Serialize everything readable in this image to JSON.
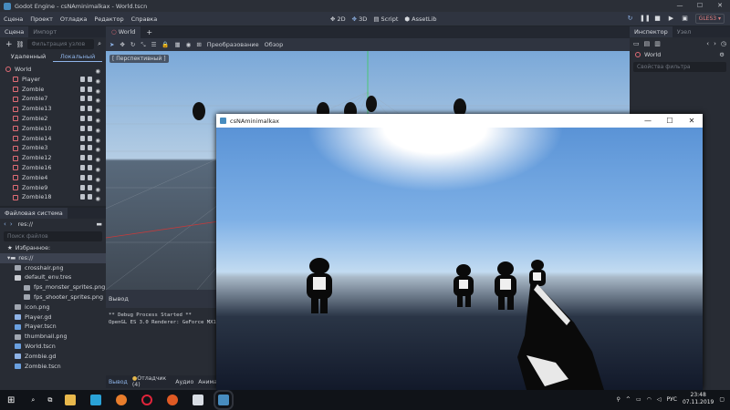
{
  "window": {
    "title": "Godot Engine - csNAminimalkax - World.tscn",
    "min": "—",
    "max": "☐",
    "close": "✕"
  },
  "menu": [
    "Сцена",
    "Проект",
    "Отладка",
    "Редактор",
    "Справка"
  ],
  "workspaces": {
    "d2": "2D",
    "d3": "3D",
    "script": "Script",
    "assetlib": "AssetLib"
  },
  "renderer": "GLES3 ▾",
  "scene_dock": {
    "tabs": [
      "Сцена",
      "Импорт"
    ],
    "filter_placeholder": "Фильтрация узлов",
    "toggle_remote": "Удаленный",
    "toggle_local": "Локальный",
    "nodes": [
      "World",
      "Player",
      "Zombie",
      "Zombie7",
      "Zombie13",
      "Zombie2",
      "Zombie10",
      "Zombie14",
      "Zombie3",
      "Zombie12",
      "Zombie16",
      "Zombie4",
      "Zombie9",
      "Zombie18"
    ]
  },
  "filesystem": {
    "title": "Файловая система",
    "path": "res://",
    "search_placeholder": "Поиск файлов",
    "favorites": "Избранное:",
    "root": "res://",
    "files": [
      "crosshair.png",
      "default_env.tres",
      "fps_monster_sprites.png",
      "fps_shooter_sprites.png",
      "icon.png",
      "Player.gd",
      "Player.tscn",
      "thumbnail.png",
      "World.tscn",
      "Zombie.gd",
      "Zombie.tscn"
    ]
  },
  "editor": {
    "scene_tab": "World",
    "add_tab": "+",
    "transform": "Преобразование",
    "view": "Обзор",
    "perspective": "[ Перспективный ]"
  },
  "output": {
    "title": "Вывод",
    "lines": [
      "** Debug Process Started **",
      "OpenGL ES 3.0 Renderer: GeForce MX1"
    ],
    "tabs": [
      "Вывод",
      "Отладчик (4)",
      "Аудио",
      "Анима"
    ]
  },
  "inspector": {
    "tabs": [
      "Инспектор",
      "Узел"
    ],
    "object": "World",
    "filter_placeholder": "Свойства фильтра"
  },
  "game_window": {
    "title": "csNAminimalkax"
  },
  "taskbar": {
    "time": "23:48",
    "date": "07.11.2019",
    "lang": "РУС"
  }
}
